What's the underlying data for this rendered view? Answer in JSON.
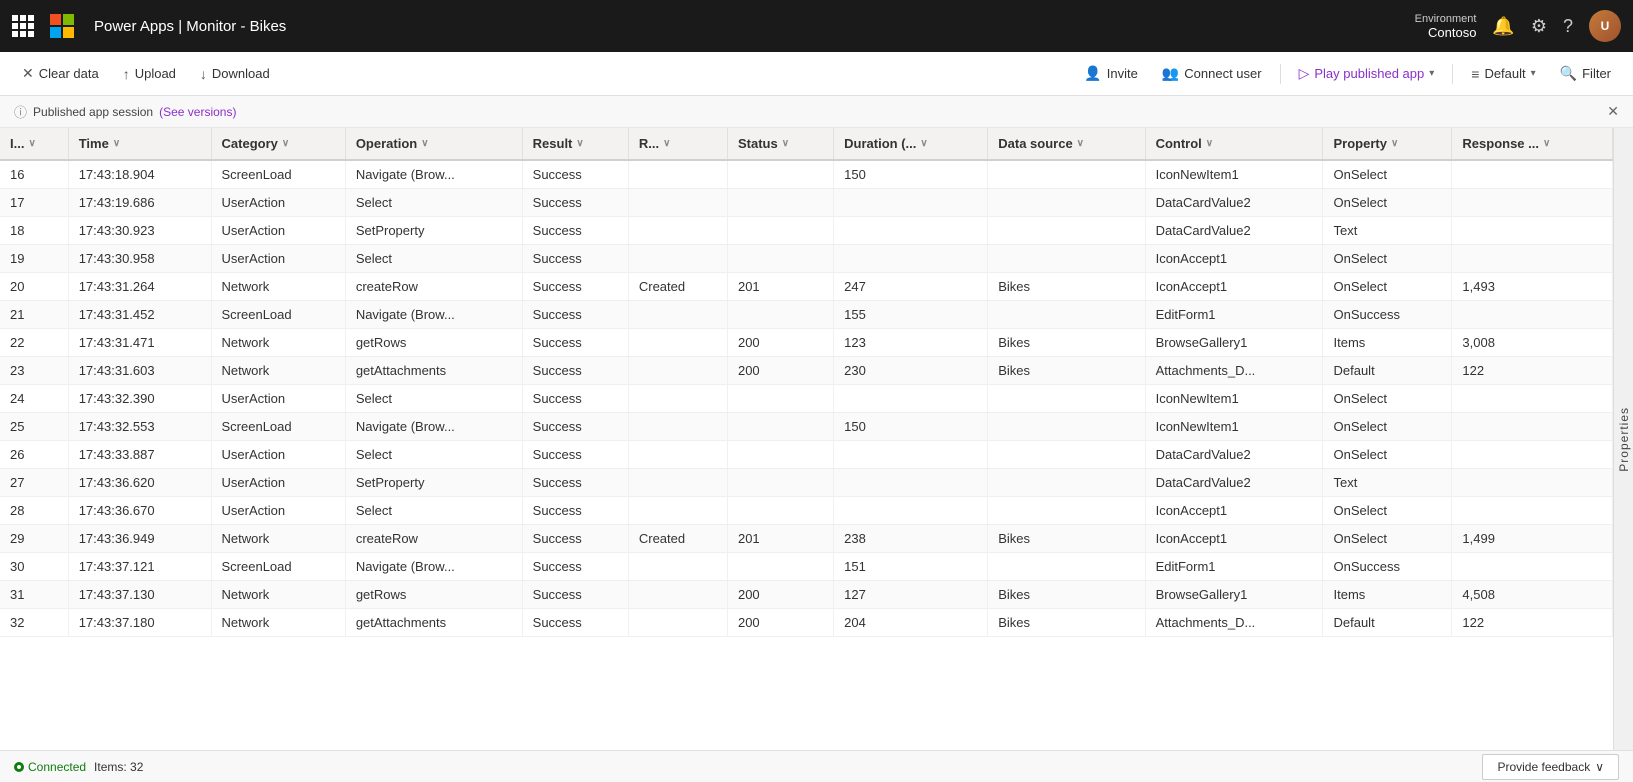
{
  "app": {
    "title": "Power Apps | Monitor - Bikes"
  },
  "nav": {
    "env_label": "Environment",
    "env_name": "Contoso",
    "avatar_initials": "U"
  },
  "toolbar": {
    "clear_data": "Clear data",
    "upload": "Upload",
    "download": "Download",
    "invite": "Invite",
    "connect_user": "Connect user",
    "play_published_app": "Play published app",
    "default": "Default",
    "filter": "Filter"
  },
  "info_bar": {
    "text": "Published app session",
    "link_text": "(See versions)"
  },
  "table": {
    "columns": [
      {
        "id": "id",
        "label": "I...",
        "sortable": true
      },
      {
        "id": "time",
        "label": "Time",
        "sortable": true
      },
      {
        "id": "category",
        "label": "Category",
        "sortable": true
      },
      {
        "id": "operation",
        "label": "Operation",
        "sortable": true
      },
      {
        "id": "result",
        "label": "Result",
        "sortable": true
      },
      {
        "id": "r",
        "label": "R...",
        "sortable": true
      },
      {
        "id": "status",
        "label": "Status",
        "sortable": true
      },
      {
        "id": "duration",
        "label": "Duration (...",
        "sortable": true
      },
      {
        "id": "datasource",
        "label": "Data source",
        "sortable": true
      },
      {
        "id": "control",
        "label": "Control",
        "sortable": true
      },
      {
        "id": "property",
        "label": "Property",
        "sortable": true
      },
      {
        "id": "response",
        "label": "Response ...",
        "sortable": true
      }
    ],
    "rows": [
      {
        "id": 16,
        "time": "17:43:18.904",
        "category": "ScreenLoad",
        "operation": "Navigate (Brow...",
        "result": "Success",
        "r": "",
        "status": "",
        "duration": 150,
        "datasource": "",
        "control": "IconNewItem1",
        "property": "OnSelect",
        "response": ""
      },
      {
        "id": 17,
        "time": "17:43:19.686",
        "category": "UserAction",
        "operation": "Select",
        "result": "Success",
        "r": "",
        "status": "",
        "duration": "",
        "datasource": "",
        "control": "DataCardValue2",
        "property": "OnSelect",
        "response": ""
      },
      {
        "id": 18,
        "time": "17:43:30.923",
        "category": "UserAction",
        "operation": "SetProperty",
        "result": "Success",
        "r": "",
        "status": "",
        "duration": "",
        "datasource": "",
        "control": "DataCardValue2",
        "property": "Text",
        "response": ""
      },
      {
        "id": 19,
        "time": "17:43:30.958",
        "category": "UserAction",
        "operation": "Select",
        "result": "Success",
        "r": "",
        "status": "",
        "duration": "",
        "datasource": "",
        "control": "IconAccept1",
        "property": "OnSelect",
        "response": ""
      },
      {
        "id": 20,
        "time": "17:43:31.264",
        "category": "Network",
        "operation": "createRow",
        "result": "Success",
        "r": "Created",
        "status": 201,
        "duration": 247,
        "datasource": "Bikes",
        "control": "IconAccept1",
        "property": "OnSelect",
        "response": "1,493"
      },
      {
        "id": 21,
        "time": "17:43:31.452",
        "category": "ScreenLoad",
        "operation": "Navigate (Brow...",
        "result": "Success",
        "r": "",
        "status": "",
        "duration": 155,
        "datasource": "",
        "control": "EditForm1",
        "property": "OnSuccess",
        "response": ""
      },
      {
        "id": 22,
        "time": "17:43:31.471",
        "category": "Network",
        "operation": "getRows",
        "result": "Success",
        "r": "",
        "status": 200,
        "duration": 123,
        "datasource": "Bikes",
        "control": "BrowseGallery1",
        "property": "Items",
        "response": "3,008"
      },
      {
        "id": 23,
        "time": "17:43:31.603",
        "category": "Network",
        "operation": "getAttachments",
        "result": "Success",
        "r": "",
        "status": 200,
        "duration": 230,
        "datasource": "Bikes",
        "control": "Attachments_D...",
        "property": "Default",
        "response": 122
      },
      {
        "id": 24,
        "time": "17:43:32.390",
        "category": "UserAction",
        "operation": "Select",
        "result": "Success",
        "r": "",
        "status": "",
        "duration": "",
        "datasource": "",
        "control": "IconNewItem1",
        "property": "OnSelect",
        "response": ""
      },
      {
        "id": 25,
        "time": "17:43:32.553",
        "category": "ScreenLoad",
        "operation": "Navigate (Brow...",
        "result": "Success",
        "r": "",
        "status": "",
        "duration": 150,
        "datasource": "",
        "control": "IconNewItem1",
        "property": "OnSelect",
        "response": ""
      },
      {
        "id": 26,
        "time": "17:43:33.887",
        "category": "UserAction",
        "operation": "Select",
        "result": "Success",
        "r": "",
        "status": "",
        "duration": "",
        "datasource": "",
        "control": "DataCardValue2",
        "property": "OnSelect",
        "response": ""
      },
      {
        "id": 27,
        "time": "17:43:36.620",
        "category": "UserAction",
        "operation": "SetProperty",
        "result": "Success",
        "r": "",
        "status": "",
        "duration": "",
        "datasource": "",
        "control": "DataCardValue2",
        "property": "Text",
        "response": ""
      },
      {
        "id": 28,
        "time": "17:43:36.670",
        "category": "UserAction",
        "operation": "Select",
        "result": "Success",
        "r": "",
        "status": "",
        "duration": "",
        "datasource": "",
        "control": "IconAccept1",
        "property": "OnSelect",
        "response": ""
      },
      {
        "id": 29,
        "time": "17:43:36.949",
        "category": "Network",
        "operation": "createRow",
        "result": "Success",
        "r": "Created",
        "status": 201,
        "duration": 238,
        "datasource": "Bikes",
        "control": "IconAccept1",
        "property": "OnSelect",
        "response": "1,499"
      },
      {
        "id": 30,
        "time": "17:43:37.121",
        "category": "ScreenLoad",
        "operation": "Navigate (Brow...",
        "result": "Success",
        "r": "",
        "status": "",
        "duration": 151,
        "datasource": "",
        "control": "EditForm1",
        "property": "OnSuccess",
        "response": ""
      },
      {
        "id": 31,
        "time": "17:43:37.130",
        "category": "Network",
        "operation": "getRows",
        "result": "Success",
        "r": "",
        "status": 200,
        "duration": 127,
        "datasource": "Bikes",
        "control": "BrowseGallery1",
        "property": "Items",
        "response": "4,508"
      },
      {
        "id": 32,
        "time": "17:43:37.180",
        "category": "Network",
        "operation": "getAttachments",
        "result": "Success",
        "r": "",
        "status": 200,
        "duration": 204,
        "datasource": "Bikes",
        "control": "Attachments_D...",
        "property": "Default",
        "response": 122
      }
    ]
  },
  "status_bar": {
    "connected_label": "Connected",
    "items_label": "Items: 32",
    "feedback_label": "Provide feedback"
  },
  "properties_panel": {
    "label": "Properties"
  }
}
